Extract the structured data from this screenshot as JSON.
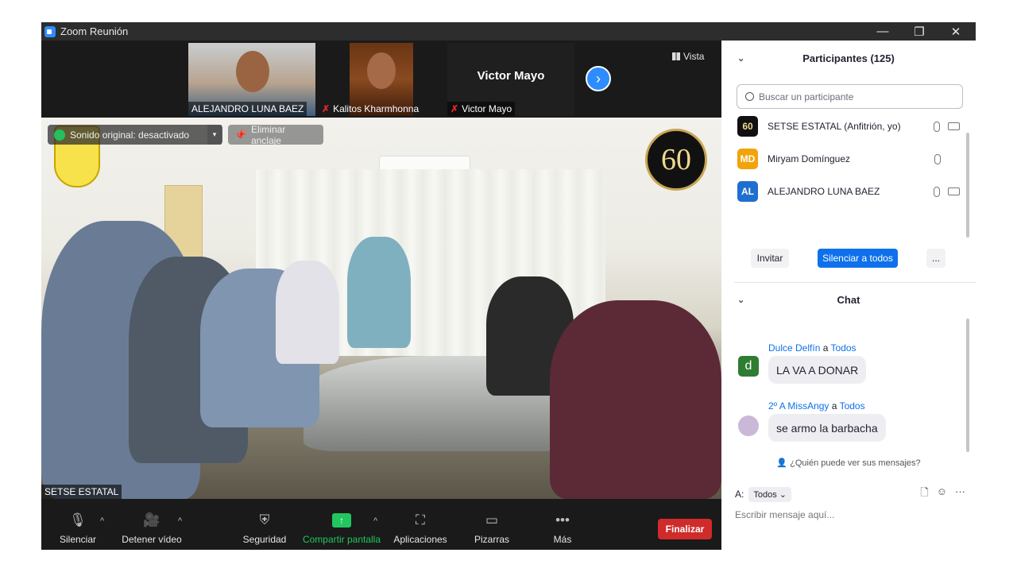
{
  "window": {
    "title": "Zoom Reunión",
    "controls": {
      "minimize": "—",
      "restore": "❐",
      "close": "✕"
    }
  },
  "strip": {
    "tiles": [
      {
        "name": "ALEJANDRO LUNA BAEZ",
        "muted": false
      },
      {
        "name": "Kalitos Kharmhonna",
        "muted": true
      },
      {
        "name": "Victor Mayo",
        "muted": true,
        "display_name": "Victor Mayo"
      }
    ],
    "next_label": "›",
    "view_label": "Vista"
  },
  "main_video": {
    "original_sound": "Sonido original: desactivado",
    "unpin": "Eliminar anclaje",
    "speaker": "SETSE ESTATAL",
    "badge": "60"
  },
  "toolbar": {
    "mute": "Silenciar",
    "video": "Detener vídeo",
    "security": "Seguridad",
    "share": "Compartir pantalla",
    "apps": "Aplicaciones",
    "whiteboards": "Pizarras",
    "more": "Más",
    "end": "Finalizar"
  },
  "participants": {
    "header": "Participantes (125)",
    "search_placeholder": "Buscar un participante",
    "list": [
      {
        "initials": "60",
        "name": "SETSE ESTATAL (Anfitrión, yo)",
        "color": "#111111"
      },
      {
        "initials": "MD",
        "name": "Miryam Domínguez",
        "color": "#f0a40a"
      },
      {
        "initials": "AL",
        "name": "ALEJANDRO LUNA BAEZ",
        "color": "#1f6fd0"
      }
    ],
    "invite": "Invitar",
    "mute_all": "Silenciar a todos",
    "more": "..."
  },
  "chat": {
    "header": "Chat",
    "messages": [
      {
        "sender": "Dulce Delfín",
        "to_word": "a",
        "to": "Todos",
        "text": "LA VA A DONAR",
        "avatar": "d",
        "avatar_color": "#2e7d32"
      },
      {
        "sender": "2º A  MissAngy",
        "to_word": "a",
        "to": "Todos",
        "text": "se armo la barbacha",
        "avatar": "",
        "avatar_color": "#c9b8d8"
      }
    ],
    "who_sees": "¿Quién puede ver sus mensajes?",
    "to_label": "A:",
    "to_value": "Todos",
    "input_placeholder": "Escribir mensaje aquí...",
    "more": "···"
  }
}
